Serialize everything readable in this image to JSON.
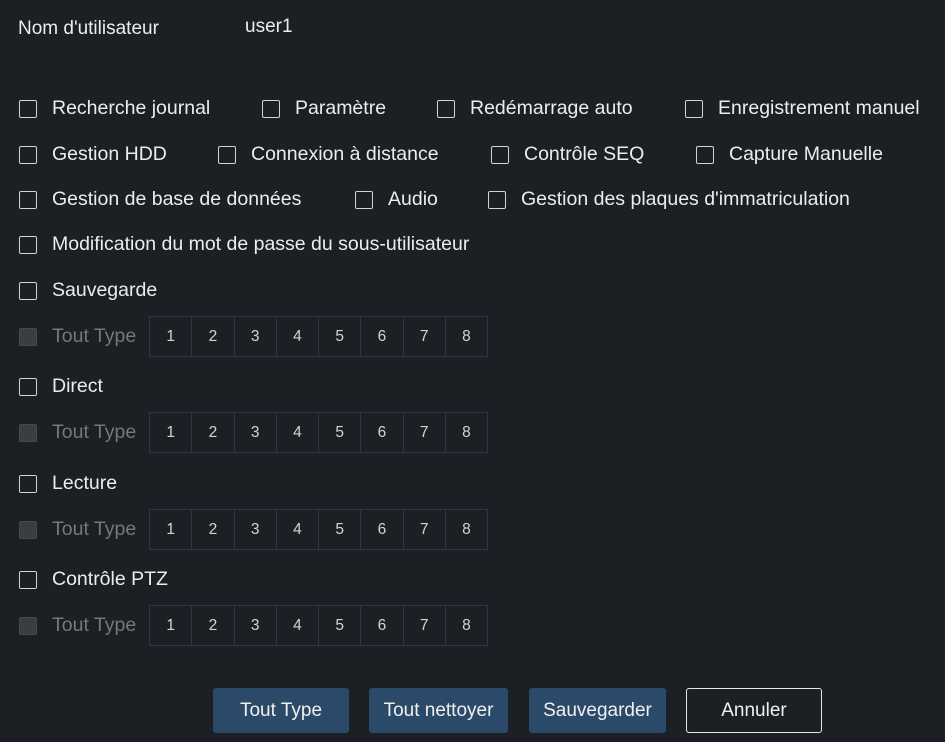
{
  "colors": {
    "background": "#1c1f24",
    "text": "#ececec",
    "text_disabled": "#74777c",
    "checkbox_border": "#d2d2d2",
    "checkbox_disabled_fill": "#3a3d42",
    "channel_border": "#2c3844",
    "button_primary": "#2b4a69",
    "button_outline": "#e6e6e6"
  },
  "user": {
    "label": "Nom d'utilisateur",
    "value": "user1"
  },
  "permissions": [
    {
      "label": "Recherche journal",
      "checked": false
    },
    {
      "label": "Paramètre",
      "checked": false
    },
    {
      "label": "Redémarrage auto",
      "checked": false
    },
    {
      "label": "Enregistrement manuel",
      "checked": false
    },
    {
      "label": "Gestion HDD",
      "checked": false
    },
    {
      "label": "Connexion à distance",
      "checked": false
    },
    {
      "label": "Contrôle SEQ",
      "checked": false
    },
    {
      "label": "Capture Manuelle",
      "checked": false
    },
    {
      "label": "Gestion de base de données",
      "checked": false
    },
    {
      "label": "Audio",
      "checked": false
    },
    {
      "label": "Gestion des plaques d'immatriculation",
      "checked": false
    },
    {
      "label": "Modification du mot de passe du sous-utilisateur",
      "checked": false
    }
  ],
  "channel_permissions": [
    {
      "label": "Sauvegarde",
      "checked": false,
      "all_type": {
        "label": "Tout Type",
        "checked": false,
        "disabled": true
      },
      "channels": [
        1,
        2,
        3,
        4,
        5,
        6,
        7,
        8
      ]
    },
    {
      "label": "Direct",
      "checked": false,
      "all_type": {
        "label": "Tout Type",
        "checked": false,
        "disabled": true
      },
      "channels": [
        1,
        2,
        3,
        4,
        5,
        6,
        7,
        8
      ]
    },
    {
      "label": "Lecture",
      "checked": false,
      "all_type": {
        "label": "Tout Type",
        "checked": false,
        "disabled": true
      },
      "channels": [
        1,
        2,
        3,
        4,
        5,
        6,
        7,
        8
      ]
    },
    {
      "label": "Contrôle PTZ",
      "checked": false,
      "all_type": {
        "label": "Tout Type",
        "checked": false,
        "disabled": true
      },
      "channels": [
        1,
        2,
        3,
        4,
        5,
        6,
        7,
        8
      ]
    }
  ],
  "buttons": {
    "all_type": "Tout Type",
    "clear_all": "Tout nettoyer",
    "save": "Sauvegarder",
    "cancel": "Annuler"
  }
}
